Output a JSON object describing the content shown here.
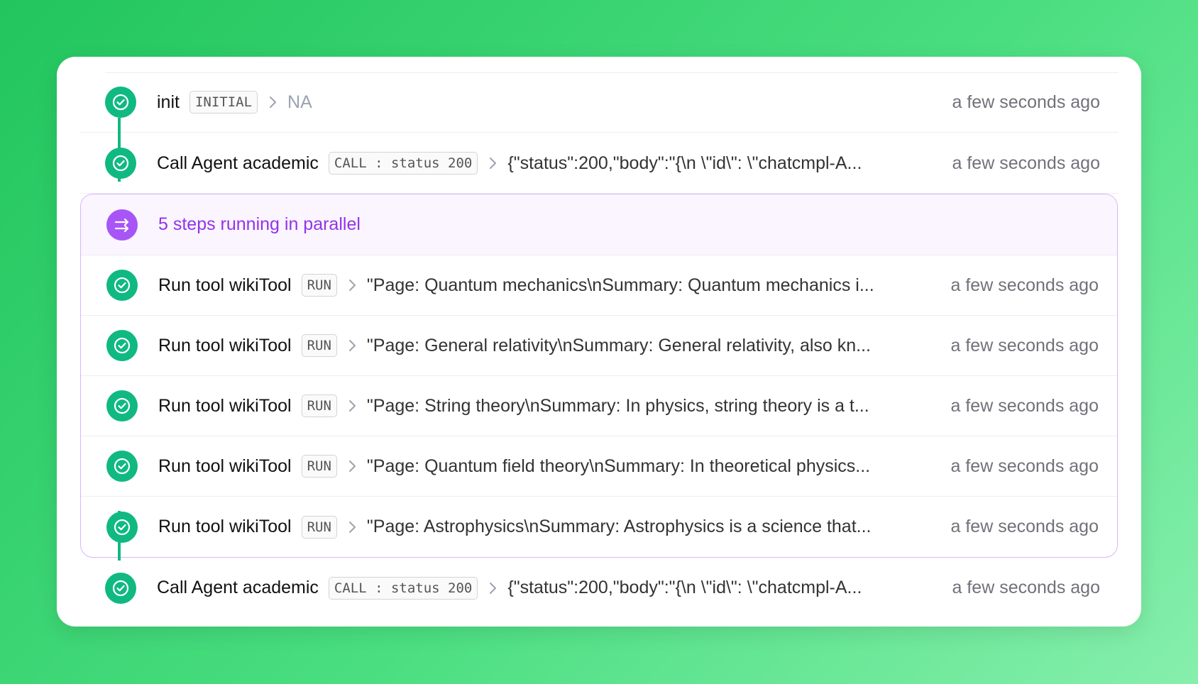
{
  "steps_before": [
    {
      "title": "init",
      "badge": "INITIAL",
      "output": "NA",
      "time": "a few seconds ago"
    },
    {
      "title": "Call Agent academic",
      "badge": "CALL : status 200",
      "output": "{\"status\":200,\"body\":\"{\\n \\\"id\\\": \\\"chatcmpl-A...",
      "time": "a few seconds ago"
    }
  ],
  "parallel_group": {
    "label": "5 steps running in parallel",
    "steps": [
      {
        "title": "Run tool wikiTool",
        "badge": "RUN",
        "output": "\"Page: Quantum mechanics\\nSummary: Quantum mechanics i...",
        "time": "a few seconds ago"
      },
      {
        "title": "Run tool wikiTool",
        "badge": "RUN",
        "output": "\"Page: General relativity\\nSummary: General relativity, also kn...",
        "time": "a few seconds ago"
      },
      {
        "title": "Run tool wikiTool",
        "badge": "RUN",
        "output": "\"Page: String theory\\nSummary: In physics, string theory is a t...",
        "time": "a few seconds ago"
      },
      {
        "title": "Run tool wikiTool",
        "badge": "RUN",
        "output": "\"Page: Quantum field theory\\nSummary: In theoretical physics...",
        "time": "a few seconds ago"
      },
      {
        "title": "Run tool wikiTool",
        "badge": "RUN",
        "output": "\"Page: Astrophysics\\nSummary: Astrophysics is a science that...",
        "time": "a few seconds ago"
      }
    ]
  },
  "steps_after": [
    {
      "title": "Call Agent academic",
      "badge": "CALL : status 200",
      "output": "{\"status\":200,\"body\":\"{\\n \\\"id\\\": \\\"chatcmpl-A...",
      "time": "a few seconds ago"
    }
  ],
  "colors": {
    "success": "#10b981",
    "parallel": "#a855f7",
    "parallel_text": "#9333ea",
    "background_gradient_start": "#22c55e",
    "background_gradient_end": "#86efac"
  },
  "icons": {
    "step_status": "check-circle-icon",
    "parallel": "parallel-arrows-icon",
    "expand": "chevron-right-icon"
  }
}
